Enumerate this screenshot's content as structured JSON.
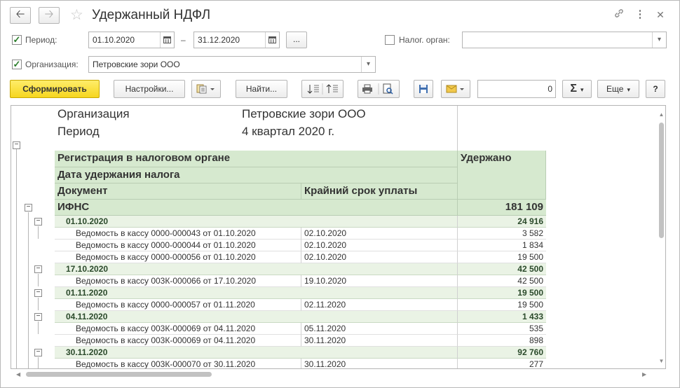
{
  "window": {
    "title": "Удержанный НДФЛ"
  },
  "filters": {
    "period_label": "Период:",
    "period_from": "01.10.2020",
    "period_dash": "–",
    "period_to": "31.12.2020",
    "period_more": "...",
    "tax_office_label": "Налог. орган:",
    "tax_office_value": "",
    "org_label": "Организация:",
    "org_value": "Петровские зори ООО"
  },
  "toolbar": {
    "generate": "Сформировать",
    "settings": "Настройки...",
    "find": "Найти...",
    "sum_value": "0",
    "more": "Еще",
    "help": "?"
  },
  "report": {
    "org_label": "Организация",
    "org_value": "Петровские зори ООО",
    "period_label": "Период",
    "period_value": "4 квартал 2020 г.",
    "col_registration": "Регистрация в налоговом органе",
    "col_date": "Дата удержания налога",
    "col_document": "Документ",
    "col_deadline": "Крайний срок уплаты",
    "col_withheld": "Удержано",
    "total_label": "ИФНС",
    "total_value": "181 109",
    "rows": [
      {
        "kind": "date",
        "label": "01.10.2020",
        "deadline": "",
        "value": "24 916"
      },
      {
        "kind": "doc",
        "label": "Ведомость в кассу 0000-000043 от 01.10.2020",
        "deadline": "02.10.2020",
        "value": "3 582"
      },
      {
        "kind": "doc",
        "label": "Ведомость в кассу 0000-000044 от 01.10.2020",
        "deadline": "02.10.2020",
        "value": "1 834"
      },
      {
        "kind": "doc",
        "label": "Ведомость в кассу 0000-000056 от 01.10.2020",
        "deadline": "02.10.2020",
        "value": "19 500"
      },
      {
        "kind": "date",
        "label": "17.10.2020",
        "deadline": "",
        "value": "42 500"
      },
      {
        "kind": "doc",
        "label": "Ведомость в кассу 003К-000066 от 17.10.2020",
        "deadline": "19.10.2020",
        "value": "42 500"
      },
      {
        "kind": "date",
        "label": "01.11.2020",
        "deadline": "",
        "value": "19 500"
      },
      {
        "kind": "doc",
        "label": "Ведомость в кассу 0000-000057 от 01.11.2020",
        "deadline": "02.11.2020",
        "value": "19 500"
      },
      {
        "kind": "date",
        "label": "04.11.2020",
        "deadline": "",
        "value": "1 433"
      },
      {
        "kind": "doc",
        "label": "Ведомость в кассу 003К-000069 от 04.11.2020",
        "deadline": "05.11.2020",
        "value": "535"
      },
      {
        "kind": "doc",
        "label": "Ведомость в кассу 003К-000069 от 04.11.2020",
        "deadline": "30.11.2020",
        "value": "898"
      },
      {
        "kind": "date",
        "label": "30.11.2020",
        "deadline": "",
        "value": "92 760"
      },
      {
        "kind": "doc",
        "label": "Ведомость в кассу 003К-000070 от 30.11.2020",
        "deadline": "30.11.2020",
        "value": "277"
      }
    ]
  }
}
